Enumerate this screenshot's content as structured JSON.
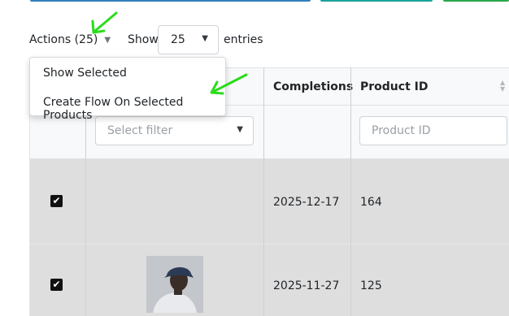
{
  "toolbar": {
    "actions_label": "Actions (25)",
    "show_label": "Show",
    "entries_value": "25",
    "entries_label": "entries"
  },
  "actions_menu": {
    "items": [
      {
        "label": "Show Selected"
      },
      {
        "label": "Create Flow On Selected Products"
      }
    ]
  },
  "table": {
    "columns": [
      "Completions",
      "Product ID"
    ],
    "filters": {
      "select_placeholder": "Select filter",
      "product_id_placeholder": "Product ID"
    },
    "rows": [
      {
        "checked": true,
        "has_image": false,
        "completions": "2025-12-17",
        "product_id": "164"
      },
      {
        "checked": true,
        "has_image": true,
        "completions": "2025-11-27",
        "product_id": "125"
      }
    ]
  },
  "colors": {
    "accent_bar_1": "#2f7fb8",
    "accent_bar_2": "#1aa39a",
    "accent_bar_3": "#2aa84a",
    "annotation_arrow": "#2bdc1b",
    "selected_row": "#dedede"
  }
}
